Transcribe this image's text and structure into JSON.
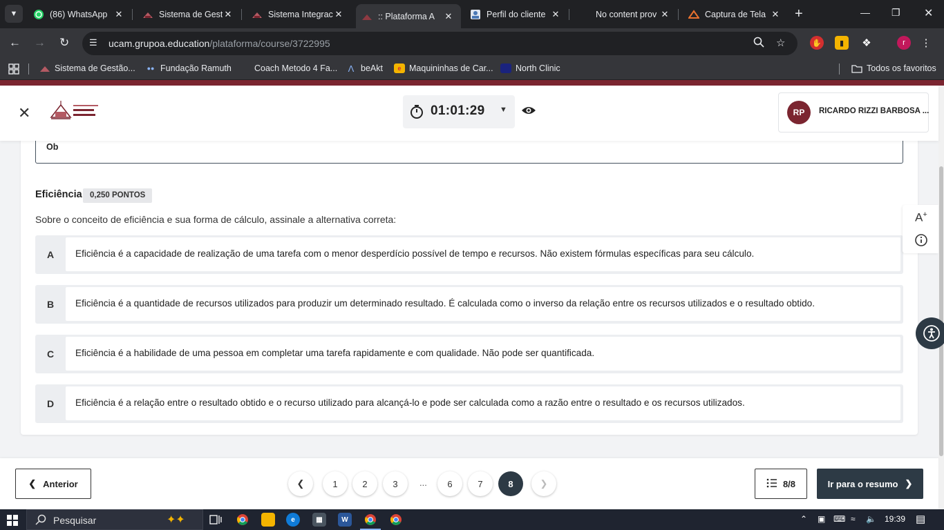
{
  "browser": {
    "tabs": [
      {
        "title": "(86) WhatsApp",
        "icon": "whatsapp-icon",
        "color": "#25d366"
      },
      {
        "title": "Sistema de Gest",
        "icon": "school-icon",
        "color": "#7b2530"
      },
      {
        "title": "Sistema Integrac",
        "icon": "school-icon",
        "color": "#7b2530"
      },
      {
        "title": ":: Plataforma A",
        "icon": "platform-icon",
        "color": "#c0392b"
      },
      {
        "title": "Perfil do cliente",
        "icon": "profile-icon",
        "color": "#dfe6f0"
      },
      {
        "title": "No content prov",
        "icon": "blank-icon",
        "color": "#202124"
      },
      {
        "title": "Captura de Tela",
        "icon": "capture-icon",
        "color": "#e8712e"
      }
    ],
    "url_domain": "ucam.grupoa.education",
    "url_path": "/plataforma/course/3722995",
    "bookmarks": [
      {
        "label": "Sistema de Gestão...",
        "icon": "school-icon"
      },
      {
        "label": "Fundação Ramuth",
        "icon": "people-icon"
      },
      {
        "label": "Coach Metodo 4 Fa...",
        "icon": "blank-icon"
      },
      {
        "label": "beAkt",
        "icon": "beakt-icon"
      },
      {
        "label": "Maquininhas de Car...",
        "icon": "card-icon"
      },
      {
        "label": "North Clinic",
        "icon": "clinic-icon"
      }
    ],
    "all_bookmarks": "Todos os favoritos"
  },
  "header": {
    "timer": "01:01:29",
    "user_initials": "RP",
    "user_name": "RICARDO RIZZI BARBOSA ..."
  },
  "previous_answer": "Ob",
  "question": {
    "title": "Eficiência",
    "points": "0,250 PONTOS",
    "text": "Sobre o conceito de eficiência e sua forma de cálculo, assinale a alternativa correta:",
    "options": [
      {
        "letter": "A",
        "text": "Eficiência é a capacidade de realização de uma tarefa com o menor desperdício possível de tempo e recursos. Não existem fórmulas específicas para seu cálculo."
      },
      {
        "letter": "B",
        "text": "Eficiência é a quantidade de recursos utilizados para produzir um determinado resultado. É calculada como o inverso da relação entre os recursos utilizados e o resultado obtido."
      },
      {
        "letter": "C",
        "text": "Eficiência é a habilidade de uma pessoa em completar uma tarefa rapidamente e com qualidade. Não pode ser quantificada."
      },
      {
        "letter": "D",
        "text": "Eficiência é a relação entre o resultado obtido e o recurso utilizado para alcançá-lo e pode ser calculada como a razão entre o resultado e os recursos utilizados."
      }
    ]
  },
  "side_tools": {
    "font_label": "A"
  },
  "footer": {
    "prev_label": "Anterior",
    "pages": [
      "1",
      "2",
      "3",
      "6",
      "7",
      "8"
    ],
    "dots": "...",
    "current_page": "8",
    "count": "8/8",
    "next_label": "Ir para o resumo"
  },
  "taskbar": {
    "search_placeholder": "Pesquisar",
    "time": "19:39"
  },
  "colors": {
    "brand": "#7b2530",
    "primary_dark": "#2d3a45"
  }
}
